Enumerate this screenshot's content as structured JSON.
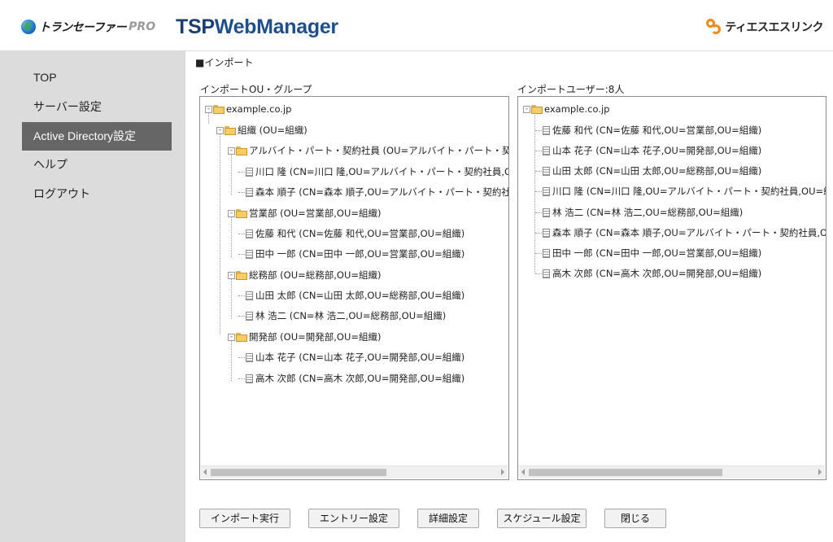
{
  "header": {
    "brand_left": "トランセーファー",
    "brand_left_suffix": "PRO",
    "app_title_prefix": "TSP",
    "app_title_suffix": "WebManager",
    "brand_right": "ティエスエスリンク"
  },
  "sidebar": {
    "items": [
      {
        "label": "TOP",
        "active": false
      },
      {
        "label": "サーバー設定",
        "active": false
      },
      {
        "label": "Active Directory設定",
        "active": true
      },
      {
        "label": "ヘルプ",
        "active": false
      },
      {
        "label": "ログアウト",
        "active": false
      }
    ]
  },
  "main": {
    "section_title": "■インポート",
    "left_panel": {
      "label": "インポートOU・グループ",
      "nodes": [
        {
          "text": "example.co.jp",
          "icon": "folder-icon",
          "expander": "⊟"
        },
        {
          "text": "組織 (OU=組織)",
          "icon": "folder-icon",
          "expander": "⊟"
        },
        {
          "text": "アルバイト・パート・契約社員 (OU=アルバイト・パート・契約社員,OU=組織)",
          "icon": "folder-icon",
          "expander": "⊟"
        },
        {
          "text": "川口 隆 (CN=川口 隆,OU=アルバイト・パート・契約社員,OU=組織)",
          "icon": "doc-icon"
        },
        {
          "text": "森本 順子 (CN=森本 順子,OU=アルバイト・パート・契約社員,OU=組織)",
          "icon": "doc-icon"
        },
        {
          "text": "営業部 (OU=営業部,OU=組織)",
          "icon": "folder-icon",
          "expander": "⊟"
        },
        {
          "text": "佐藤 和代 (CN=佐藤 和代,OU=営業部,OU=組織)",
          "icon": "doc-icon"
        },
        {
          "text": "田中 一郎 (CN=田中 一郎,OU=営業部,OU=組織)",
          "icon": "doc-icon"
        },
        {
          "text": "総務部 (OU=総務部,OU=組織)",
          "icon": "folder-icon",
          "expander": "⊟"
        },
        {
          "text": "山田 太郎 (CN=山田 太郎,OU=総務部,OU=組織)",
          "icon": "doc-icon"
        },
        {
          "text": "林 浩二 (CN=林 浩二,OU=総務部,OU=組織)",
          "icon": "doc-icon"
        },
        {
          "text": "開発部 (OU=開発部,OU=組織)",
          "icon": "folder-icon",
          "expander": "⊟"
        },
        {
          "text": "山本 花子 (CN=山本 花子,OU=開発部,OU=組織)",
          "icon": "doc-icon"
        },
        {
          "text": "高木 次郎 (CN=高木 次郎,OU=開発部,OU=組織)",
          "icon": "doc-icon"
        }
      ],
      "scroll_fraction": 0.76
    },
    "right_panel": {
      "label": "インポートユーザー:8人",
      "nodes": [
        {
          "text": "example.co.jp",
          "icon": "folder-icon",
          "expander": "⊟"
        },
        {
          "text": "佐藤 和代 (CN=佐藤 和代,OU=営業部,OU=組織)",
          "icon": "doc-icon"
        },
        {
          "text": "山本 花子 (CN=山本 花子,OU=開発部,OU=組織)",
          "icon": "doc-icon"
        },
        {
          "text": "山田 太郎 (CN=山田 太郎,OU=総務部,OU=組織)",
          "icon": "doc-icon"
        },
        {
          "text": "川口 隆 (CN=川口 隆,OU=アルバイト・パート・契約社員,OU=組織)",
          "icon": "doc-icon"
        },
        {
          "text": "林 浩二 (CN=林 浩二,OU=総務部,OU=組織)",
          "icon": "doc-icon"
        },
        {
          "text": "森本 順子 (CN=森本 順子,OU=アルバイト・パート・契約社員,OU=組織)",
          "icon": "doc-icon"
        },
        {
          "text": "田中 一郎 (CN=田中 一郎,OU=営業部,OU=組織)",
          "icon": "doc-icon"
        },
        {
          "text": "高木 次郎 (CN=高木 次郎,OU=開発部,OU=組織)",
          "icon": "doc-icon"
        }
      ],
      "scroll_fraction": 0.94
    },
    "buttons": [
      {
        "label": "インポート実行"
      },
      {
        "label": "エントリー設定"
      },
      {
        "label": "詳細設定"
      },
      {
        "label": "スケジュール設定"
      },
      {
        "label": "閉じる"
      }
    ]
  },
  "colors": {
    "sidebar_bg": "#dcdcdc",
    "sidebar_active_bg": "#666666",
    "title_blue": "#1e4e8c",
    "brand_orange": "#f08a1c"
  }
}
